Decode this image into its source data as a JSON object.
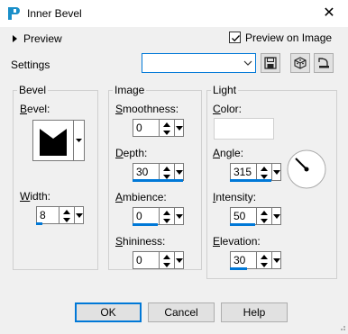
{
  "window": {
    "title": "Inner Bevel",
    "close_glyph": "✕"
  },
  "top": {
    "preview_label": "Preview",
    "preview_on_image_label": "Preview on Image",
    "preview_on_image_checked": true,
    "settings_label": "Settings",
    "settings_value": ""
  },
  "groups": {
    "bevel": {
      "title": "Bevel",
      "bevel_label": "Bevel:",
      "width_label": "Width:",
      "width_value": "8"
    },
    "image": {
      "title": "Image",
      "smoothness_label": "Smoothness:",
      "smoothness_value": "0",
      "depth_label": "Depth:",
      "depth_value": "30",
      "ambience_label": "Ambience:",
      "ambience_value": "0",
      "shininess_label": "Shininess:",
      "shininess_value": "0"
    },
    "light": {
      "title": "Light",
      "color_label": "Color:",
      "angle_label": "Angle:",
      "angle_value": "315",
      "intensity_label": "Intensity:",
      "intensity_value": "50",
      "elevation_label": "Elevation:",
      "elevation_value": "30"
    }
  },
  "buttons": {
    "ok": "OK",
    "cancel": "Cancel",
    "help": "Help"
  },
  "colors": {
    "accent": "#0078d7",
    "window_bg": "#f0f0f0",
    "light_color": "#ffffff"
  },
  "icons": [
    "app-icon",
    "close-icon",
    "expand-arrow-icon",
    "checkbox-check-icon",
    "dropdown-arrow-icon",
    "save-preset-icon",
    "cube-icon",
    "reset-icon",
    "bevel-shape-icon",
    "spin-arrows-icon",
    "angle-dial-icon"
  ]
}
